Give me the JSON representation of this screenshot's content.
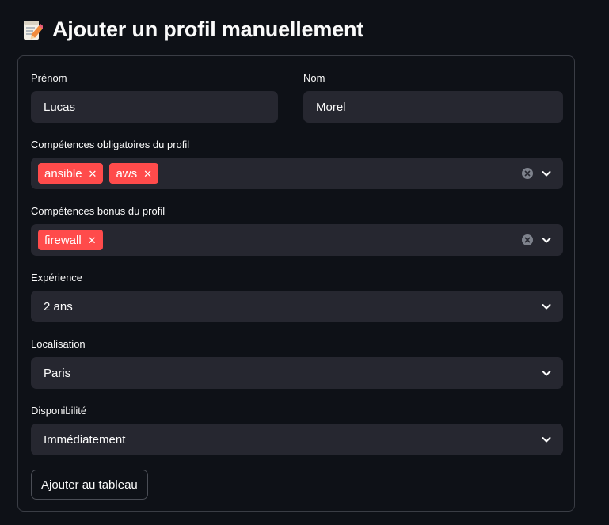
{
  "page": {
    "title": "Ajouter un profil manuellement",
    "title_icon": "memo-pencil-icon"
  },
  "form": {
    "prenom": {
      "label": "Prénom",
      "value": "Lucas"
    },
    "nom": {
      "label": "Nom",
      "value": "Morel"
    },
    "competences_obligatoires": {
      "label": "Compétences obligatoires du profil",
      "tags": [
        "ansible",
        "aws"
      ]
    },
    "competences_bonus": {
      "label": "Compétences bonus du profil",
      "tags": [
        "firewall"
      ]
    },
    "experience": {
      "label": "Expérience",
      "value": "2 ans"
    },
    "localisation": {
      "label": "Localisation",
      "value": "Paris"
    },
    "disponibilite": {
      "label": "Disponibilité",
      "value": "Immédiatement"
    },
    "submit_label": "Ajouter au tableau"
  },
  "colors": {
    "background": "#0e1117",
    "input_bg": "#262730",
    "tag_bg": "#ff4b4b",
    "border": "#3a3d45"
  }
}
